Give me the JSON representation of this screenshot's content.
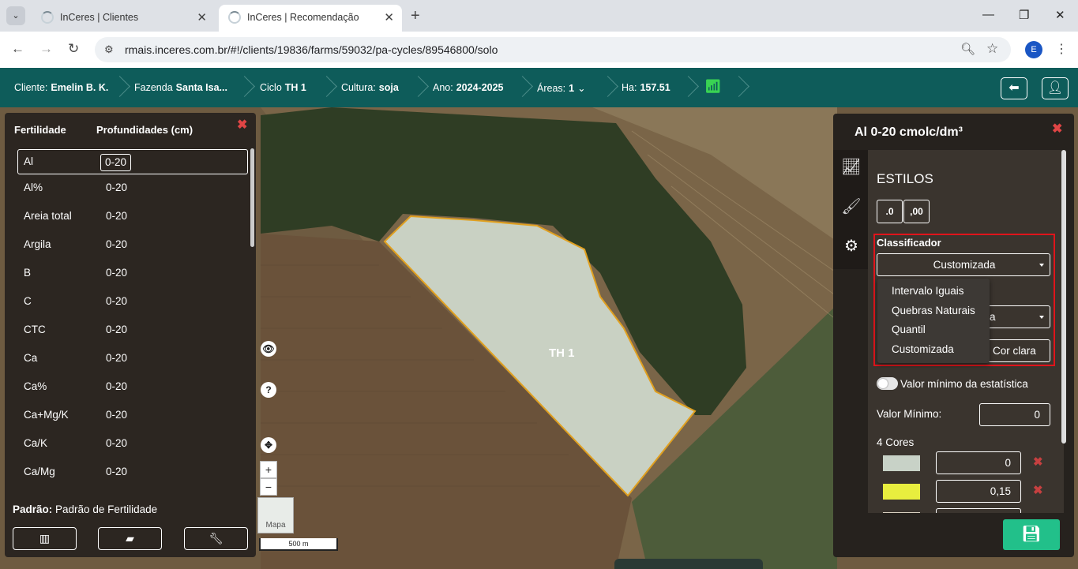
{
  "browser": {
    "tabs": [
      {
        "title": "InCeres | Clientes"
      },
      {
        "title": "InCeres | Recomendação"
      }
    ],
    "url": "rmais.inceres.com.br/#!/clients/19836/farms/59032/pa-cycles/89546800/solo",
    "profile_initial": "E"
  },
  "header": {
    "cliente_label": "Cliente:",
    "cliente": "Emelin B. K.",
    "fazenda_label": "Fazenda",
    "fazenda": "Santa Isa...",
    "ciclo_label": "Ciclo",
    "ciclo": "TH 1",
    "cultura_label": "Cultura:",
    "cultura": "soja",
    "ano_label": "Ano:",
    "ano": "2024-2025",
    "areas_label": "Áreas:",
    "areas": "1",
    "ha_label": "Ha:",
    "ha": "157.51"
  },
  "map": {
    "field_label": "TH 1",
    "tile_label": "Mapa",
    "scale_label": "500 m"
  },
  "left_panel": {
    "col_fertilidade": "Fertilidade",
    "col_profundidades": "Profundidades (cm)",
    "rows": [
      {
        "name": "Al",
        "depth": "0-20"
      },
      {
        "name": "Al%",
        "depth": "0-20"
      },
      {
        "name": "Areia total",
        "depth": "0-20"
      },
      {
        "name": "Argila",
        "depth": "0-20"
      },
      {
        "name": "B",
        "depth": "0-20"
      },
      {
        "name": "C",
        "depth": "0-20"
      },
      {
        "name": "CTC",
        "depth": "0-20"
      },
      {
        "name": "Ca",
        "depth": "0-20"
      },
      {
        "name": "Ca%",
        "depth": "0-20"
      },
      {
        "name": "Ca+Mg/K",
        "depth": "0-20"
      },
      {
        "name": "Ca/K",
        "depth": "0-20"
      },
      {
        "name": "Ca/Mg",
        "depth": "0-20"
      }
    ],
    "footer_label": "Padrão:",
    "footer_value": "Padrão de Fertilidade"
  },
  "right_panel": {
    "title": "Al 0-20 cmolc/dm³",
    "section": "ESTILOS",
    "dec_less": ".0",
    "dec_more": ",00",
    "classificador_label": "Classificador",
    "classificador_value": "Customizada",
    "classificador_options": [
      "Intervalo Iguais",
      "Quebras Naturais",
      "Quantil",
      "Customizada"
    ],
    "second_select_partial": "a",
    "color_button_partial": "Cor clara",
    "toggle_label": "Valor mínimo da estatística",
    "valor_minimo_label": "Valor Mínimo:",
    "valor_minimo": "0",
    "cores_label": "4 Cores",
    "classes": [
      {
        "color": "#c8d2c7",
        "value": "0"
      },
      {
        "color": "#e8ee3e",
        "value": "0,15"
      },
      {
        "color": "#d8d0c0",
        "value": ""
      }
    ]
  }
}
